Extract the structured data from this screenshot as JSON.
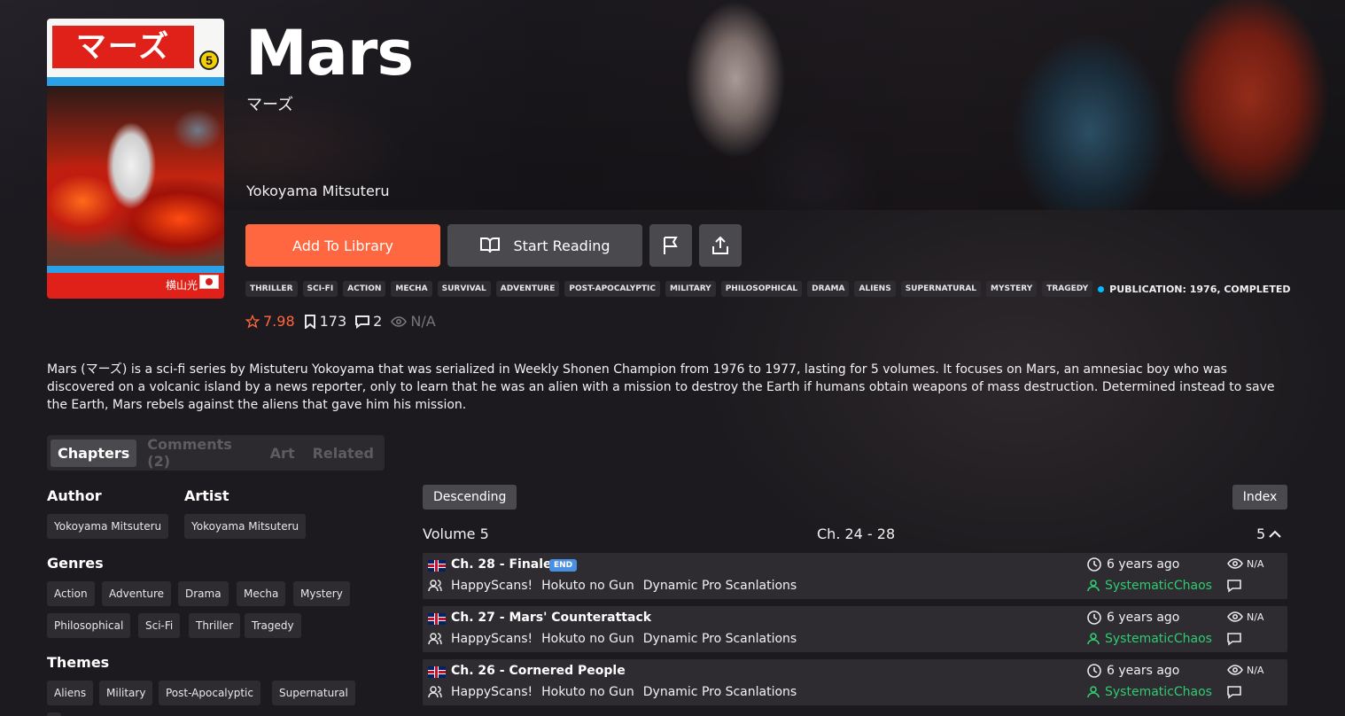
{
  "manga": {
    "title": "Mars",
    "alt_title": "マーズ",
    "author": "Yokoyama Mitsuteru",
    "cover": {
      "title_text": "マーズ",
      "volume": "5",
      "author_text": "横山光"
    }
  },
  "actions": {
    "add_to_library": "Add To Library",
    "start_reading": "Start Reading",
    "report_icon": "flag-icon",
    "share_icon": "share-icon"
  },
  "tags": [
    "THRILLER",
    "SCI-FI",
    "ACTION",
    "MECHA",
    "SURVIVAL",
    "ADVENTURE",
    "POST-APOCALYPTIC",
    "MILITARY",
    "PHILOSOPHICAL",
    "DRAMA",
    "ALIENS",
    "SUPERNATURAL",
    "MYSTERY",
    "TRAGEDY"
  ],
  "publication": "PUBLICATION: 1976, COMPLETED",
  "stats": {
    "rating": "7.98",
    "follows": "173",
    "comments": "2",
    "views": "N/A"
  },
  "description": "Mars (マーズ) is a sci-fi series by Mistuteru Yokoyama that was serialized in Weekly Shonen Champion from 1976 to 1977, lasting for 5 volumes. It focuses on Mars, an amnesiac boy who was discovered on a volcanic island by a news reporter, only to learn that he was an alien with a mission to destroy the Earth if humans obtain weapons of mass destruction. Determined instead to save the Earth, Mars rebels against the aliens that gave him his mission.",
  "tabs": [
    "Chapters",
    "Comments (2)",
    "Art",
    "Related"
  ],
  "info": {
    "author_heading": "Author",
    "author": "Yokoyama Mitsuteru",
    "artist_heading": "Artist",
    "artist": "Yokoyama Mitsuteru",
    "genres_heading": "Genres",
    "genres": [
      "Action",
      "Adventure",
      "Drama",
      "Mecha",
      "Mystery",
      "Philosophical",
      "Sci-Fi",
      "Thriller",
      "Tragedy"
    ],
    "themes_heading": "Themes",
    "themes": [
      "Aliens",
      "Military",
      "Post-Apocalyptic",
      "Supernatural"
    ]
  },
  "chapters": {
    "sort_label": "Descending",
    "index_label": "Index",
    "volume_label": "Volume 5",
    "range": "Ch. 24 - 28",
    "count": "5",
    "list": [
      {
        "title": "Ch. 28 - Finale",
        "badge": "END",
        "groups": [
          "HappyScans!",
          "Hokuto no Gun",
          "Dynamic Pro Scanlations"
        ],
        "time": "6 years ago",
        "views": "N/A",
        "uploader": "SystematicChaos"
      },
      {
        "title": "Ch. 27 - Mars' Counterattack",
        "badge": "",
        "groups": [
          "HappyScans!",
          "Hokuto no Gun",
          "Dynamic Pro Scanlations"
        ],
        "time": "6 years ago",
        "views": "N/A",
        "uploader": "SystematicChaos"
      },
      {
        "title": "Ch. 26 - Cornered People",
        "badge": "",
        "groups": [
          "HappyScans!",
          "Hokuto no Gun",
          "Dynamic Pro Scanlations"
        ],
        "time": "6 years ago",
        "views": "N/A",
        "uploader": "SystematicChaos"
      }
    ]
  },
  "colors": {
    "accent": "#ff6740",
    "uploader": "#2ecc71",
    "badge": "#4a90e2",
    "pub_dot": "#04bbff"
  }
}
